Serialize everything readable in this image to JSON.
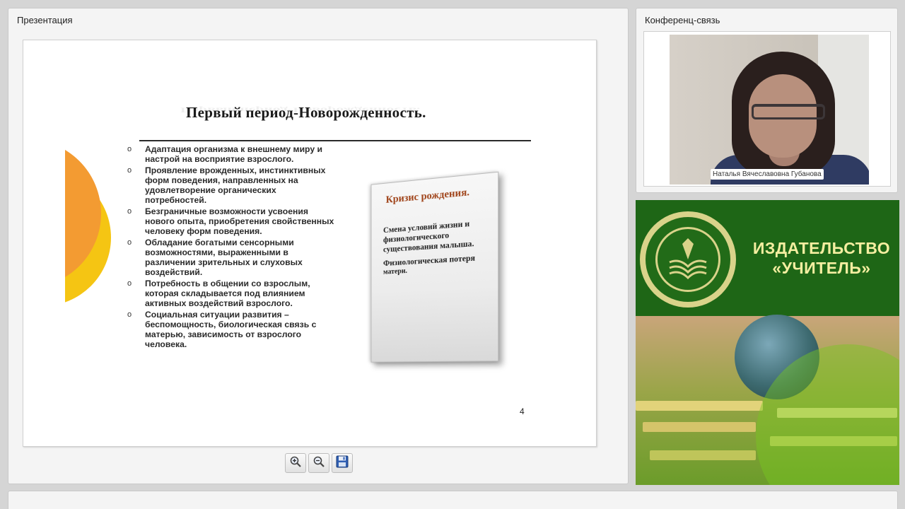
{
  "presentation": {
    "panel_title": "Презентация",
    "slide": {
      "title": "Первый период-Новорожденность.",
      "bullets": [
        "Адаптация организма  к внешнему миру и настрой на восприятие взрослого.",
        "Проявление врожденных, инстинктивных форм поведения, направленных на удовлетворение органических потребностей.",
        "Безграничные возможности усвоения нового опыта, приобретения свойственных человеку форм поведения.",
        "Обладание богатыми сенсорными возможностями, выраженными  в различении зрительных и слуховых воздействий.",
        "Потребность в общении со взрослым, которая складывается под влиянием активных воздействий взрослого.",
        "Социальная ситуации развития – беспомощность, биологическая связь с матерью, зависимость от взрослого человека."
      ],
      "bullet_marker": "o",
      "callout": {
        "title": "Кризис рождения.",
        "text_1": "Смена условий жизни и физиологического существования малыша.",
        "text_2": "Физиологическая потеря",
        "text_3": "матери."
      },
      "page_number": "4"
    },
    "toolbar": {
      "zoom_in_icon": "zoom-in-icon",
      "zoom_out_icon": "zoom-out-icon",
      "save_icon": "floppy-disk-icon"
    }
  },
  "conference": {
    "panel_title": "Конференц-связь",
    "participant_name": "Наталья Вячеславовна Губанова"
  },
  "publisher": {
    "line_1": "ИЗДАТЕЛЬСТВО",
    "line_2": "«УЧИТЕЛЬ»",
    "brand_color": "#1e6616",
    "text_color": "#f4eea0"
  }
}
